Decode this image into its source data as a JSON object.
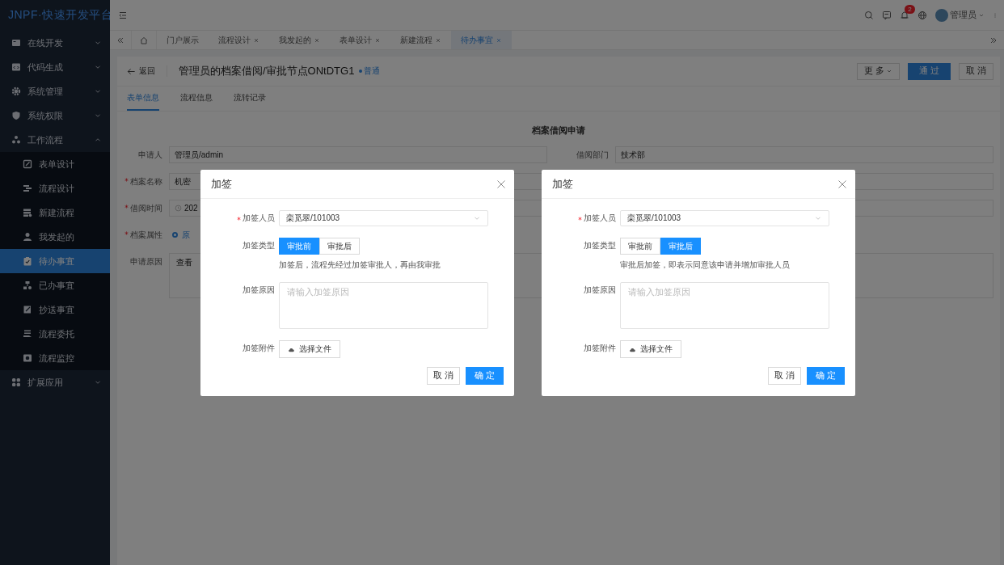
{
  "logo": "JNPF·快速开发平台",
  "sidebar": {
    "items": [
      {
        "label": "在线开发",
        "expanded": false
      },
      {
        "label": "代码生成",
        "expanded": false
      },
      {
        "label": "系统管理",
        "expanded": false
      },
      {
        "label": "系统权限",
        "expanded": false
      },
      {
        "label": "工作流程",
        "expanded": true,
        "children": [
          {
            "label": "表单设计",
            "selected": false
          },
          {
            "label": "流程设计",
            "selected": false
          },
          {
            "label": "新建流程",
            "selected": false
          },
          {
            "label": "我发起的",
            "selected": false
          },
          {
            "label": "待办事宜",
            "selected": true
          },
          {
            "label": "已办事宜",
            "selected": false
          },
          {
            "label": "抄送事宜",
            "selected": false
          },
          {
            "label": "流程委托",
            "selected": false
          },
          {
            "label": "流程监控",
            "selected": false
          }
        ]
      },
      {
        "label": "扩展应用",
        "expanded": false
      }
    ]
  },
  "header": {
    "notification_count": "2",
    "user": "管理员"
  },
  "tabs": [
    {
      "label": "门户展示",
      "closable": false,
      "selected": false
    },
    {
      "label": "流程设计",
      "closable": true,
      "selected": false
    },
    {
      "label": "我发起的",
      "closable": true,
      "selected": false
    },
    {
      "label": "表单设计",
      "closable": true,
      "selected": false
    },
    {
      "label": "新建流程",
      "closable": true,
      "selected": false
    },
    {
      "label": "待办事宜",
      "closable": true,
      "selected": true
    }
  ],
  "page": {
    "back": "返回",
    "title": "管理员的档案借阅/审批节点ONtDTG1",
    "tag": "普通",
    "buttons": [
      {
        "label": "更 多",
        "kind": "dropdown"
      },
      {
        "label": "通 过",
        "kind": "primary"
      },
      {
        "label": "取 消",
        "kind": "default"
      }
    ],
    "subtabs": [
      {
        "label": "表单信息",
        "selected": true
      },
      {
        "label": "流程信息",
        "selected": false
      },
      {
        "label": "流转记录",
        "selected": false
      }
    ],
    "form": {
      "title": "档案借阅申请",
      "fields": [
        {
          "label": "申请人",
          "required": false,
          "value": "管理员/admin",
          "kind": "input"
        },
        {
          "label": "借阅部门",
          "required": false,
          "value": "技术部",
          "kind": "input"
        },
        {
          "label": "档案名称",
          "required": true,
          "value": "机密",
          "kind": "input"
        },
        {
          "kind": "input"
        },
        {
          "label": "借阅时间",
          "required": true,
          "value": "202",
          "kind": "date"
        },
        {
          "kind": "input"
        },
        {
          "label": "档案属性",
          "required": true,
          "value": "原",
          "kind": "radio",
          "checked": true
        },
        {
          "label": "申请原因",
          "required": false,
          "value": "查看",
          "kind": "textarea"
        }
      ]
    }
  },
  "dialogs": [
    {
      "title": "加签",
      "approver": {
        "label": "加签人员",
        "required": true,
        "value": "栾觅翠/101003"
      },
      "type": {
        "label": "加签类型",
        "options": [
          {
            "label": "审批前",
            "selected": true
          },
          {
            "label": "审批后",
            "selected": false
          }
        ],
        "hint": "加签后，流程先经过加签审批人，再由我审批"
      },
      "reason": {
        "label": "加签原因",
        "placeholder": "请输入加签原因"
      },
      "attachment": {
        "label": "加签附件",
        "button": "选择文件"
      },
      "buttons": [
        {
          "label": "取 消",
          "kind": "default"
        },
        {
          "label": "确 定",
          "kind": "primary"
        }
      ]
    },
    {
      "title": "加签",
      "approver": {
        "label": "加签人员",
        "required": true,
        "value": "栾觅翠/101003"
      },
      "type": {
        "label": "加签类型",
        "options": [
          {
            "label": "审批前",
            "selected": false
          },
          {
            "label": "审批后",
            "selected": true
          }
        ],
        "hint": "审批后加签，即表示同意该申请并增加审批人员"
      },
      "reason": {
        "label": "加签原因",
        "placeholder": "请输入加签原因"
      },
      "attachment": {
        "label": "加签附件",
        "button": "选择文件"
      },
      "buttons": [
        {
          "label": "取 消",
          "kind": "default"
        },
        {
          "label": "确 定",
          "kind": "primary"
        }
      ]
    }
  ]
}
